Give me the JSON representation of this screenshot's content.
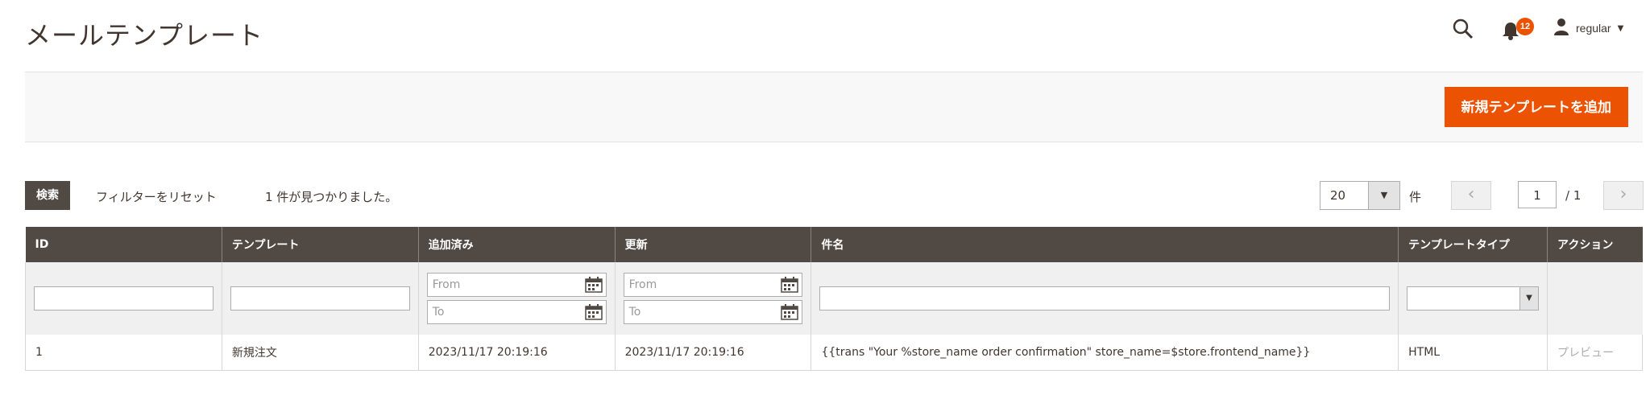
{
  "page": {
    "title": "メールテンプレート"
  },
  "header": {
    "notifications_count": "12",
    "user_name": "regular"
  },
  "actions": {
    "add_button": "新規テンプレートを追加"
  },
  "toolbar": {
    "search_label": "検索",
    "reset_label": "フィルターをリセット",
    "records_found": "1 件が見つかりました。",
    "per_page": "20",
    "per_page_label": "件",
    "current_page": "1",
    "total_pages": "/ 1"
  },
  "grid": {
    "columns": [
      "ID",
      "テンプレート",
      "追加済み",
      "更新",
      "件名",
      "テンプレートタイプ",
      "アクション"
    ],
    "filters": {
      "from_placeholder": "From",
      "to_placeholder": "To"
    },
    "rows": [
      {
        "id": "1",
        "template": "新規注文",
        "added": "2023/11/17 20:19:16",
        "updated": "2023/11/17 20:19:16",
        "subject": "{{trans \"Your %store_name order confirmation\" store_name=$store.frontend_name}}",
        "type": "HTML",
        "action": "プレビュー"
      }
    ]
  }
}
